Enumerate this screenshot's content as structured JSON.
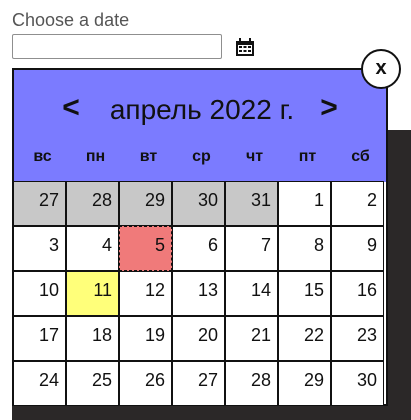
{
  "field": {
    "label": "Choose a date",
    "value": "",
    "placeholder": ""
  },
  "calendar": {
    "prev_label": "<",
    "next_label": ">",
    "month_title": "апрель 2022 г.",
    "close_label": "x",
    "weekdays": [
      "вс",
      "пн",
      "вт",
      "ср",
      "чт",
      "пт",
      "сб"
    ],
    "weeks": [
      [
        "27",
        "28",
        "29",
        "30",
        "31",
        "1",
        "2"
      ],
      [
        "3",
        "4",
        "5",
        "6",
        "7",
        "8",
        "9"
      ],
      [
        "10",
        "11",
        "12",
        "13",
        "14",
        "15",
        "16"
      ],
      [
        "17",
        "18",
        "19",
        "20",
        "21",
        "22",
        "23"
      ],
      [
        "24",
        "25",
        "26",
        "27",
        "28",
        "29",
        "30"
      ]
    ],
    "other_month_count_first_week": 5,
    "selected_day": "5",
    "today_day": "11"
  },
  "colors": {
    "header_bg": "#7b7bff",
    "other_month_bg": "#c8c8c8",
    "selected_bg": "#f07a7a",
    "today_bg": "#ffff7a"
  }
}
